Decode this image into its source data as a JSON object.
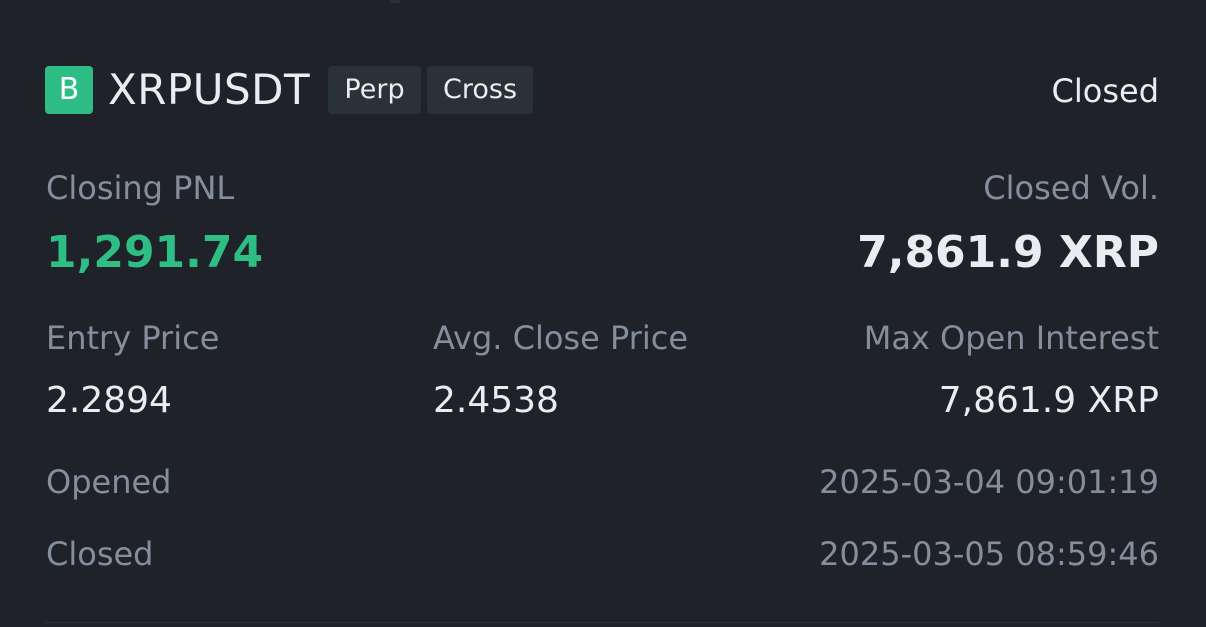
{
  "header": {
    "side_badge": "B",
    "symbol": "XRPUSDT",
    "tags": [
      "Perp",
      "Cross"
    ],
    "status": "Closed"
  },
  "pnl": {
    "label": "Closing PNL",
    "value": "1,291.74"
  },
  "closed_vol": {
    "label": "Closed Vol.",
    "value": "7,861.9 XRP"
  },
  "entry_price": {
    "label": "Entry Price",
    "value": "2.2894"
  },
  "avg_close_price": {
    "label": "Avg. Close Price",
    "value": "2.4538"
  },
  "max_open_interest": {
    "label": "Max Open Interest",
    "value": "7,861.9 XRP"
  },
  "opened": {
    "label": "Opened",
    "value": "2025-03-04 09:01:19"
  },
  "closed": {
    "label": "Closed",
    "value": "2025-03-05 08:59:46"
  },
  "colors": {
    "background": "#1f2229",
    "profit_green": "#2ebd85",
    "muted_text": "#848e9c",
    "primary_text": "#eaecef",
    "tag_bg": "#2b3139"
  }
}
